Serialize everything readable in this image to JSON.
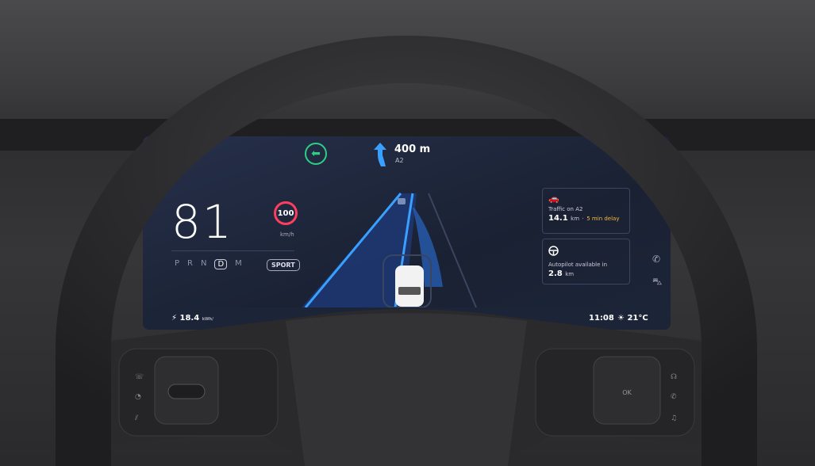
{
  "speed": {
    "value": "81",
    "unit": "km/h",
    "limit": "100"
  },
  "gears": {
    "items": [
      "P",
      "R",
      "N",
      "D",
      "M"
    ],
    "active": "D",
    "mode": "SPORT"
  },
  "navigation": {
    "turn_icon": "arrow-left-icon",
    "maneuver_icon": "keep-left-arrow-icon",
    "distance": "400 m",
    "road": "A2"
  },
  "cards": [
    {
      "icon": "traffic-cars-icon",
      "title": "Traffic on A2",
      "value": "14.1",
      "unit": "km",
      "sep": "·",
      "delay": "5 min delay"
    },
    {
      "icon": "steering-wheel-icon",
      "title": "Autopilot available in",
      "value": "2.8",
      "unit": "km"
    }
  ],
  "status": {
    "energy_icon": "bolt-icon",
    "energy": "18.4",
    "energy_unit": "kWh/",
    "time": "11:08",
    "weather_icon": "sun-icon",
    "temperature": "21°C"
  },
  "side_icons": [
    "phone-icon",
    "car-icon"
  ],
  "wheel_buttons": {
    "ok": "OK"
  },
  "colors": {
    "accent_blue": "#2f8fff",
    "turn_green": "#2ecf85",
    "limit_red": "#ff3e5f",
    "delay_amber": "#f5b942",
    "screen_bg": "#1c2436"
  }
}
